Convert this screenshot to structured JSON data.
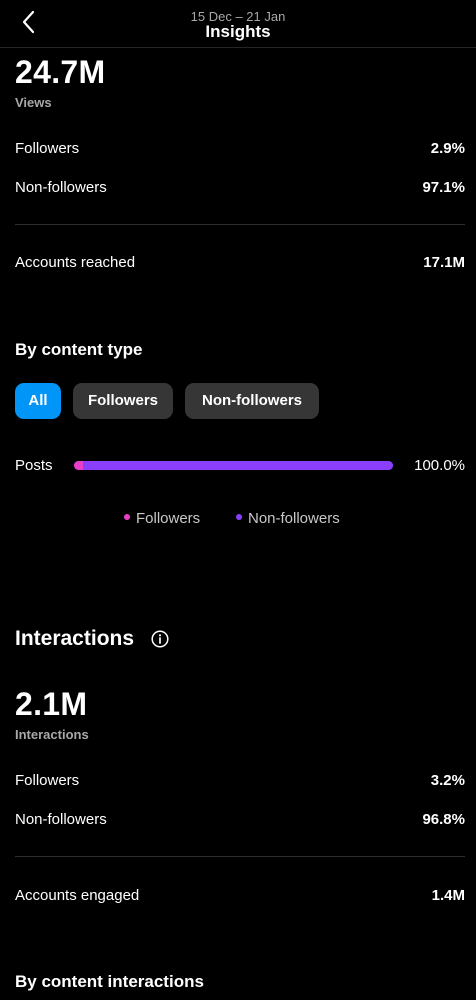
{
  "header": {
    "date_range": "15 Dec – 21 Jan",
    "title": "Insights"
  },
  "views": {
    "value": "24.7M",
    "caption": "Views",
    "rows": [
      {
        "label": "Followers",
        "value": "2.9%"
      },
      {
        "label": "Non-followers",
        "value": "97.1%"
      }
    ],
    "reach": {
      "label": "Accounts reached",
      "value": "17.1M"
    }
  },
  "content_type": {
    "title": "By content type",
    "chips": [
      "All",
      "Followers",
      "Non-followers"
    ],
    "active_chip": "All",
    "bar": {
      "label": "Posts",
      "percent_label": "100.0%",
      "followers_fraction": 0.029,
      "nonfollowers_fraction": 0.971,
      "followers_color": "#e83fc8",
      "nonfollowers_color": "#8a3ffc"
    },
    "legend": [
      {
        "label": "Followers",
        "color": "#e83fc8"
      },
      {
        "label": "Non-followers",
        "color": "#8a3ffc"
      }
    ]
  },
  "interactions": {
    "title": "Interactions",
    "info_icon": "info-circle-icon",
    "value": "2.1M",
    "caption": "Interactions",
    "rows": [
      {
        "label": "Followers",
        "value": "3.2%"
      },
      {
        "label": "Non-followers",
        "value": "96.8%"
      }
    ],
    "engaged": {
      "label": "Accounts engaged",
      "value": "1.4M"
    }
  },
  "content_interactions": {
    "title": "By content interactions"
  },
  "colors": {
    "accent": "#0095f6",
    "chip_bg": "#363636",
    "background": "#000000"
  }
}
